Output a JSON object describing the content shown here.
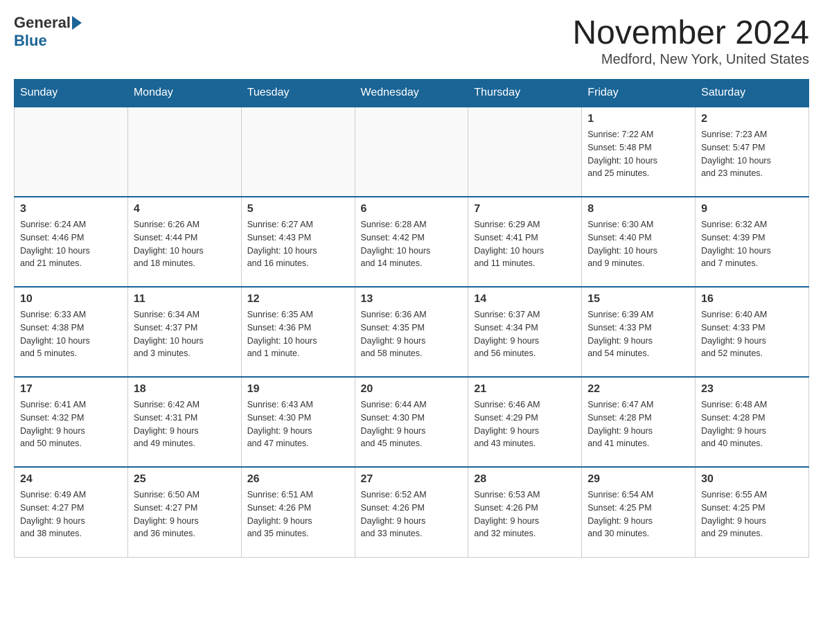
{
  "header": {
    "logo_general": "General",
    "logo_blue": "Blue",
    "title": "November 2024",
    "subtitle": "Medford, New York, United States"
  },
  "weekdays": [
    "Sunday",
    "Monday",
    "Tuesday",
    "Wednesday",
    "Thursday",
    "Friday",
    "Saturday"
  ],
  "weeks": [
    [
      {
        "day": "",
        "info": ""
      },
      {
        "day": "",
        "info": ""
      },
      {
        "day": "",
        "info": ""
      },
      {
        "day": "",
        "info": ""
      },
      {
        "day": "",
        "info": ""
      },
      {
        "day": "1",
        "info": "Sunrise: 7:22 AM\nSunset: 5:48 PM\nDaylight: 10 hours\nand 25 minutes."
      },
      {
        "day": "2",
        "info": "Sunrise: 7:23 AM\nSunset: 5:47 PM\nDaylight: 10 hours\nand 23 minutes."
      }
    ],
    [
      {
        "day": "3",
        "info": "Sunrise: 6:24 AM\nSunset: 4:46 PM\nDaylight: 10 hours\nand 21 minutes."
      },
      {
        "day": "4",
        "info": "Sunrise: 6:26 AM\nSunset: 4:44 PM\nDaylight: 10 hours\nand 18 minutes."
      },
      {
        "day": "5",
        "info": "Sunrise: 6:27 AM\nSunset: 4:43 PM\nDaylight: 10 hours\nand 16 minutes."
      },
      {
        "day": "6",
        "info": "Sunrise: 6:28 AM\nSunset: 4:42 PM\nDaylight: 10 hours\nand 14 minutes."
      },
      {
        "day": "7",
        "info": "Sunrise: 6:29 AM\nSunset: 4:41 PM\nDaylight: 10 hours\nand 11 minutes."
      },
      {
        "day": "8",
        "info": "Sunrise: 6:30 AM\nSunset: 4:40 PM\nDaylight: 10 hours\nand 9 minutes."
      },
      {
        "day": "9",
        "info": "Sunrise: 6:32 AM\nSunset: 4:39 PM\nDaylight: 10 hours\nand 7 minutes."
      }
    ],
    [
      {
        "day": "10",
        "info": "Sunrise: 6:33 AM\nSunset: 4:38 PM\nDaylight: 10 hours\nand 5 minutes."
      },
      {
        "day": "11",
        "info": "Sunrise: 6:34 AM\nSunset: 4:37 PM\nDaylight: 10 hours\nand 3 minutes."
      },
      {
        "day": "12",
        "info": "Sunrise: 6:35 AM\nSunset: 4:36 PM\nDaylight: 10 hours\nand 1 minute."
      },
      {
        "day": "13",
        "info": "Sunrise: 6:36 AM\nSunset: 4:35 PM\nDaylight: 9 hours\nand 58 minutes."
      },
      {
        "day": "14",
        "info": "Sunrise: 6:37 AM\nSunset: 4:34 PM\nDaylight: 9 hours\nand 56 minutes."
      },
      {
        "day": "15",
        "info": "Sunrise: 6:39 AM\nSunset: 4:33 PM\nDaylight: 9 hours\nand 54 minutes."
      },
      {
        "day": "16",
        "info": "Sunrise: 6:40 AM\nSunset: 4:33 PM\nDaylight: 9 hours\nand 52 minutes."
      }
    ],
    [
      {
        "day": "17",
        "info": "Sunrise: 6:41 AM\nSunset: 4:32 PM\nDaylight: 9 hours\nand 50 minutes."
      },
      {
        "day": "18",
        "info": "Sunrise: 6:42 AM\nSunset: 4:31 PM\nDaylight: 9 hours\nand 49 minutes."
      },
      {
        "day": "19",
        "info": "Sunrise: 6:43 AM\nSunset: 4:30 PM\nDaylight: 9 hours\nand 47 minutes."
      },
      {
        "day": "20",
        "info": "Sunrise: 6:44 AM\nSunset: 4:30 PM\nDaylight: 9 hours\nand 45 minutes."
      },
      {
        "day": "21",
        "info": "Sunrise: 6:46 AM\nSunset: 4:29 PM\nDaylight: 9 hours\nand 43 minutes."
      },
      {
        "day": "22",
        "info": "Sunrise: 6:47 AM\nSunset: 4:28 PM\nDaylight: 9 hours\nand 41 minutes."
      },
      {
        "day": "23",
        "info": "Sunrise: 6:48 AM\nSunset: 4:28 PM\nDaylight: 9 hours\nand 40 minutes."
      }
    ],
    [
      {
        "day": "24",
        "info": "Sunrise: 6:49 AM\nSunset: 4:27 PM\nDaylight: 9 hours\nand 38 minutes."
      },
      {
        "day": "25",
        "info": "Sunrise: 6:50 AM\nSunset: 4:27 PM\nDaylight: 9 hours\nand 36 minutes."
      },
      {
        "day": "26",
        "info": "Sunrise: 6:51 AM\nSunset: 4:26 PM\nDaylight: 9 hours\nand 35 minutes."
      },
      {
        "day": "27",
        "info": "Sunrise: 6:52 AM\nSunset: 4:26 PM\nDaylight: 9 hours\nand 33 minutes."
      },
      {
        "day": "28",
        "info": "Sunrise: 6:53 AM\nSunset: 4:26 PM\nDaylight: 9 hours\nand 32 minutes."
      },
      {
        "day": "29",
        "info": "Sunrise: 6:54 AM\nSunset: 4:25 PM\nDaylight: 9 hours\nand 30 minutes."
      },
      {
        "day": "30",
        "info": "Sunrise: 6:55 AM\nSunset: 4:25 PM\nDaylight: 9 hours\nand 29 minutes."
      }
    ]
  ]
}
